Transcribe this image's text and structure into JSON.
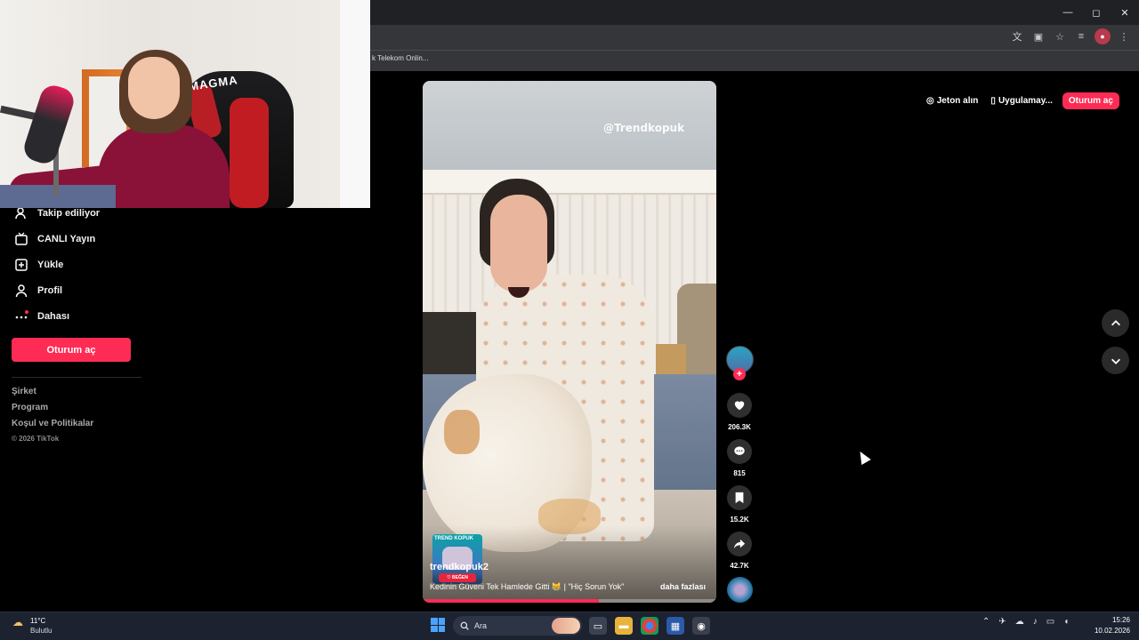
{
  "browser": {
    "bookmark": "k Telekom Onlin...",
    "window_controls": [
      "—",
      "◻",
      "✕"
    ]
  },
  "webcam": {
    "chair_brand": "MAGMA"
  },
  "sidebar": {
    "items": [
      {
        "label": "Takip ediliyor",
        "icon": "following-icon"
      },
      {
        "label": "CANLI Yayın",
        "icon": "live-tv-icon"
      },
      {
        "label": "Yükle",
        "icon": "upload-icon"
      },
      {
        "label": "Profil",
        "icon": "profile-icon"
      },
      {
        "label": "Dahası",
        "icon": "more-icon"
      }
    ],
    "login_label": "Oturum aç",
    "footer_links": [
      "Şirket",
      "Program",
      "Koşul ve Politikalar"
    ],
    "copyright": "© 2026 TikTok"
  },
  "header": {
    "coins_label": "Jeton alın",
    "app_label": "Uygulamay...",
    "login_label": "Oturum aç"
  },
  "video": {
    "watermark": "@Trendkopuk",
    "avatar_card_label": "TREND KOPUK",
    "avatar_badge": "♡ BEĞEN",
    "username": "trendkopuk2",
    "caption": "Kedinin Güveni Tek Hamlede Gitti 😹 | \"Hiç Sorun Yok\"",
    "more_label": "daha fazlası",
    "progress": 0.6
  },
  "actions": {
    "follow_plus": "+",
    "likes": "206.3K",
    "comments": "815",
    "saves": "15.2K",
    "shares": "42.7K"
  },
  "taskbar": {
    "temperature": "11°C",
    "weather": "Bulutlu",
    "search_placeholder": "Ara",
    "time": "15:26",
    "date": "10.02.2026"
  },
  "colors": {
    "accent": "#fe2c55",
    "background": "#000000",
    "taskbar": "#1c2230"
  }
}
